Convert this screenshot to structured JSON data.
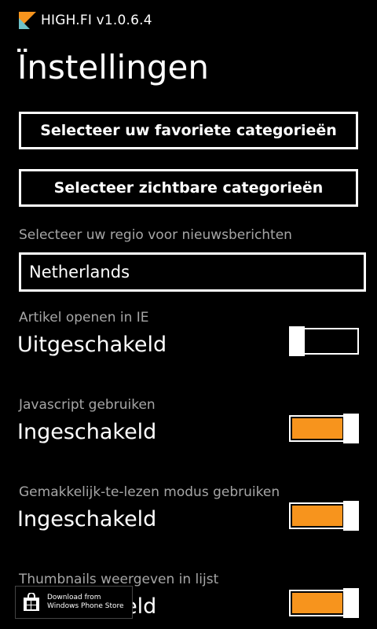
{
  "header": {
    "app_title": "HIGH.FI v1.0.6.4"
  },
  "page": {
    "title": "Ïnstellingen"
  },
  "buttons": {
    "favorite_categories": "Selecteer uw favoriete categorieën",
    "visible_categories": "Selecteer zichtbare categorieën"
  },
  "region": {
    "label": "Selecteer uw regio voor nieuwsberichten",
    "value": "Netherlands"
  },
  "settings": [
    {
      "label": "Artikel openen in IE",
      "state": "Uitgeschakeld",
      "on": false
    },
    {
      "label": "Javascript gebruiken",
      "state": "Ingeschakeld",
      "on": true
    },
    {
      "label": "Gemakkelijk-te-lezen modus gebruiken",
      "state": "Ingeschakeld",
      "on": true
    },
    {
      "label": "Thumbnails weergeven in lijst",
      "state": "Ingeschakeld",
      "on": true
    }
  ],
  "store_badge": {
    "line1": "Download from",
    "line2": "Windows Phone Store"
  },
  "colors": {
    "accent": "#f7941d",
    "background": "#000000",
    "label_gray": "#a6a6a6"
  }
}
